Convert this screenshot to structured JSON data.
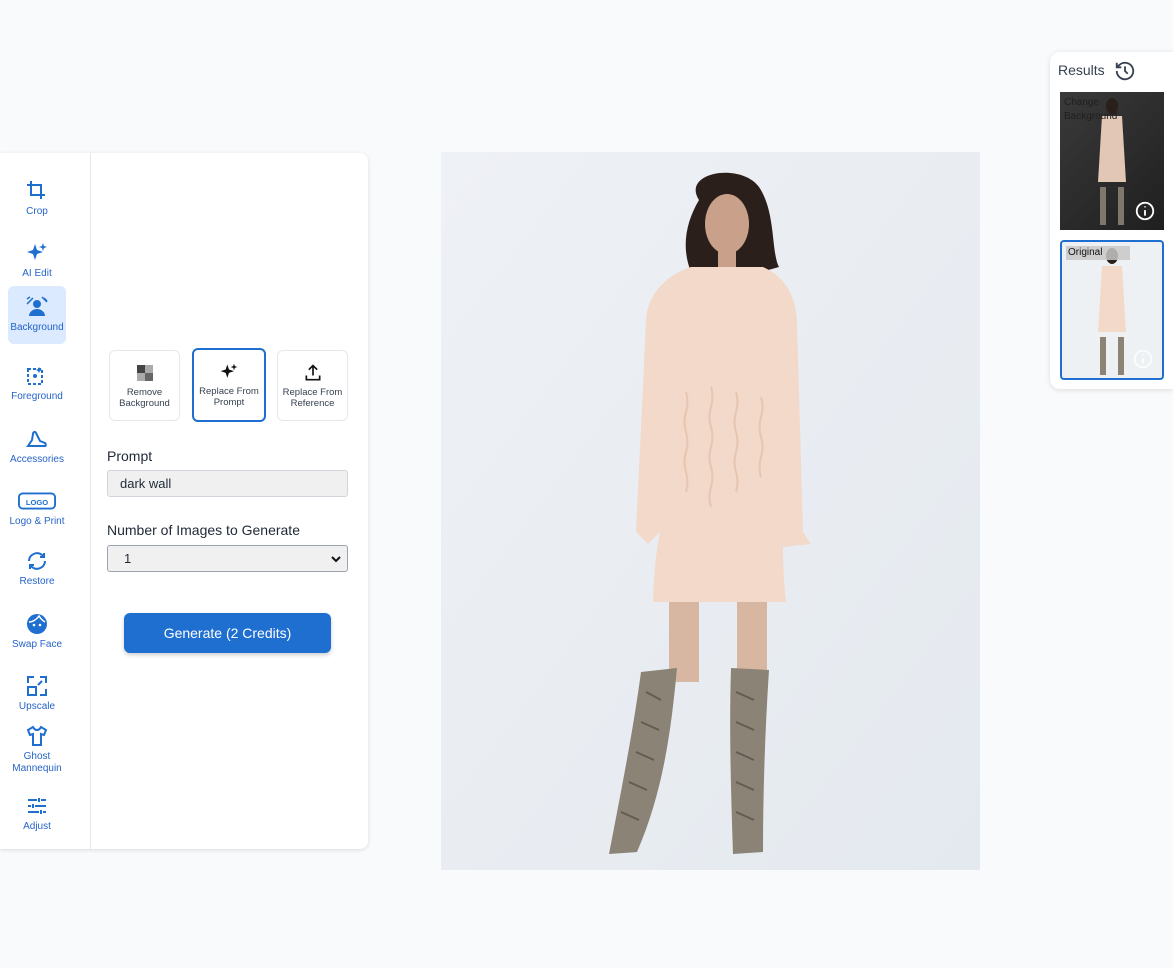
{
  "tools": [
    {
      "label": "Crop",
      "icon": "crop-icon"
    },
    {
      "label": "AI Edit",
      "icon": "sparkles-icon"
    },
    {
      "label": "Background",
      "icon": "background-icon"
    },
    {
      "label": "Foreground",
      "icon": "foreground-icon"
    },
    {
      "label": "Accessories",
      "icon": "heel-shoe-icon"
    },
    {
      "label": "Logo & Print",
      "icon": "logo-icon"
    },
    {
      "label": "Restore",
      "icon": "restore-icon"
    },
    {
      "label": "Swap Face",
      "icon": "face-icon"
    },
    {
      "label": "Upscale",
      "icon": "upscale-icon"
    },
    {
      "label": "Ghost\nMannequin",
      "icon": "shirt-icon"
    },
    {
      "label": "Adjust",
      "icon": "sliders-icon"
    }
  ],
  "logo_badge_text": "LOGO",
  "active_tool": "Background",
  "options": [
    {
      "label": "Remove Background",
      "icon": "checker-icon"
    },
    {
      "label": "Replace From Prompt",
      "icon": "sparkles-icon"
    },
    {
      "label": "Replace From Reference",
      "icon": "upload-icon"
    }
  ],
  "active_option": "Replace From Prompt",
  "prompt": {
    "label": "Prompt",
    "value": "dark wall"
  },
  "num_images": {
    "label": "Number of Images to Generate",
    "value": "1"
  },
  "generate_button": "Generate (2 Credits)",
  "results": {
    "title": "Results",
    "items": [
      {
        "label": "Change Background",
        "style": "dark"
      },
      {
        "label": "Original",
        "style": "original"
      }
    ]
  },
  "colors": {
    "accent": "#1e6fd0",
    "active_bg": "#dbeafe",
    "dress": "#f3d9c9",
    "boot": "#8c8377"
  }
}
